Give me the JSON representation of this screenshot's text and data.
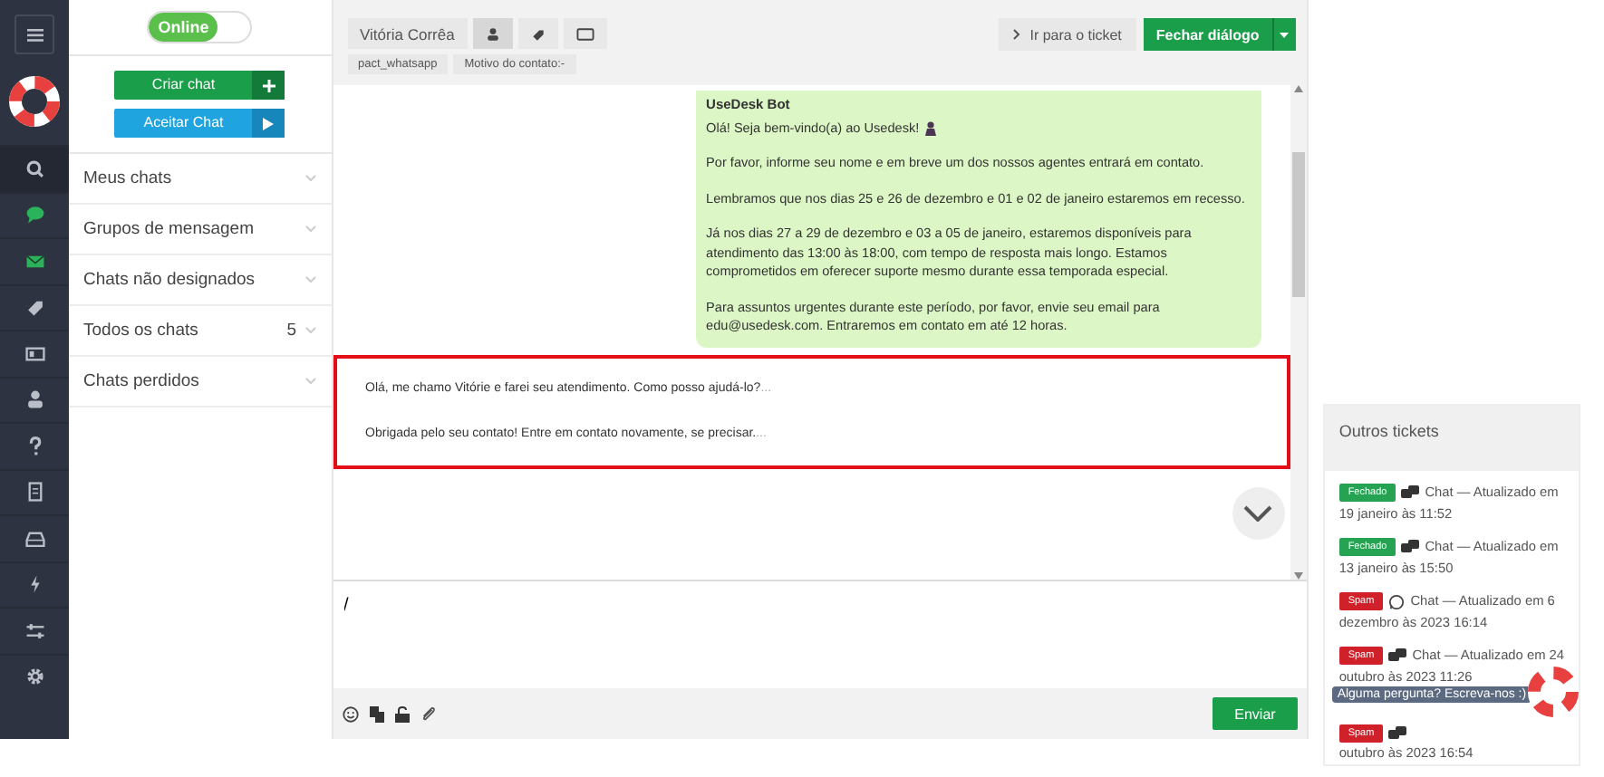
{
  "rail": {
    "items": [
      {
        "selected": true
      },
      {
        "selected": false
      },
      {
        "selected": false
      },
      {
        "selected": false
      },
      {
        "selected": false
      },
      {
        "selected": false
      },
      {
        "selected": false
      },
      {
        "selected": false
      },
      {
        "selected": false
      },
      {
        "selected": false
      },
      {
        "selected": false
      },
      {
        "selected": false
      }
    ]
  },
  "status_toggle": {
    "label": "Online",
    "on": true
  },
  "actions": [
    {
      "label": "Criar chat",
      "kind": "create"
    },
    {
      "label": "Aceitar Chat",
      "kind": "accept"
    }
  ],
  "sidebar": {
    "items": [
      {
        "label": "Meus chats"
      },
      {
        "label": "Grupos de mensagem"
      },
      {
        "label": "Chats não designados"
      },
      {
        "label": "Todos os chats",
        "count": "5"
      },
      {
        "label": "Chats perdidos"
      }
    ]
  },
  "header": {
    "tabs": [
      {
        "kind": "name",
        "label": "Vitória Corrêa",
        "selected": false
      },
      {
        "kind": "person",
        "selected": true
      },
      {
        "kind": "tag",
        "selected": false
      },
      {
        "kind": "window",
        "selected": false
      }
    ],
    "tags": [
      "pact_whatsapp",
      "Motivo do contato:-"
    ],
    "goto_button": "Ir para o ticket",
    "close_button": "Fechar diálogo"
  },
  "message": {
    "sender": "UseDesk Bot",
    "paragraphs": [
      "Olá! Seja bem-vindo(a) ao Usedesk!",
      "Por favor, informe seu nome e em breve um dos nossos agentes entrará em contato.",
      "Lembramos que nos dias 25 e 26 de dezembro e 01 e 02 de janeiro estaremos em recesso.",
      "Já nos dias 27 a 29 de dezembro e 03 a 05 de janeiro, estaremos disponíveis para atendimento das 13:00 às 18:00, com tempo de resposta mais longo. Estamos comprometidos em oferecer suporte mesmo durante essa temporada especial.",
      "Para assuntos urgentes durante este período, por favor, envie seu email para edu@usedesk.com. Entraremos em contato em até 12 horas."
    ]
  },
  "quick_replies": [
    {
      "text": "Olá, me chamo Vitórie e farei seu atendimento. Como posso ajudá-lo?",
      "more": "..."
    },
    {
      "text": "Obrigada pelo seu contato! Entre em contato novamente, se precisar.",
      "more": "..."
    }
  ],
  "composer": {
    "value": "/",
    "send_button": "Enviar"
  },
  "other_tickets": {
    "title": "Outros tickets",
    "items": [
      {
        "status": {
          "label": "Fechado",
          "kind": "closed"
        },
        "kind": "chat",
        "heading": "Chat — Atualizado em",
        "detail": "19 janeiro às 11:52"
      },
      {
        "status": {
          "label": "Fechado",
          "kind": "closed"
        },
        "kind": "chat",
        "heading": "Chat — Atualizado em",
        "detail": "13 janeiro às 15:50"
      },
      {
        "status": {
          "label": "Spam",
          "kind": "spam"
        },
        "kind": "whatsapp",
        "heading": "Chat — Atualizado em 6",
        "detail": "dezembro às 2023 16:14"
      },
      {
        "status": {
          "label": "Spam",
          "kind": "spam"
        },
        "kind": "chat",
        "heading": "Chat — Atualizado em 24",
        "detail": "outubro às 2023 11:26"
      },
      {
        "status": {
          "label": "Spam",
          "kind": "spam"
        },
        "kind": "chat",
        "detail": "outubro às 2023 16:54"
      }
    ]
  },
  "help_widget": {
    "tooltip": "Alguma pergunta? Escreva-nos :)"
  }
}
